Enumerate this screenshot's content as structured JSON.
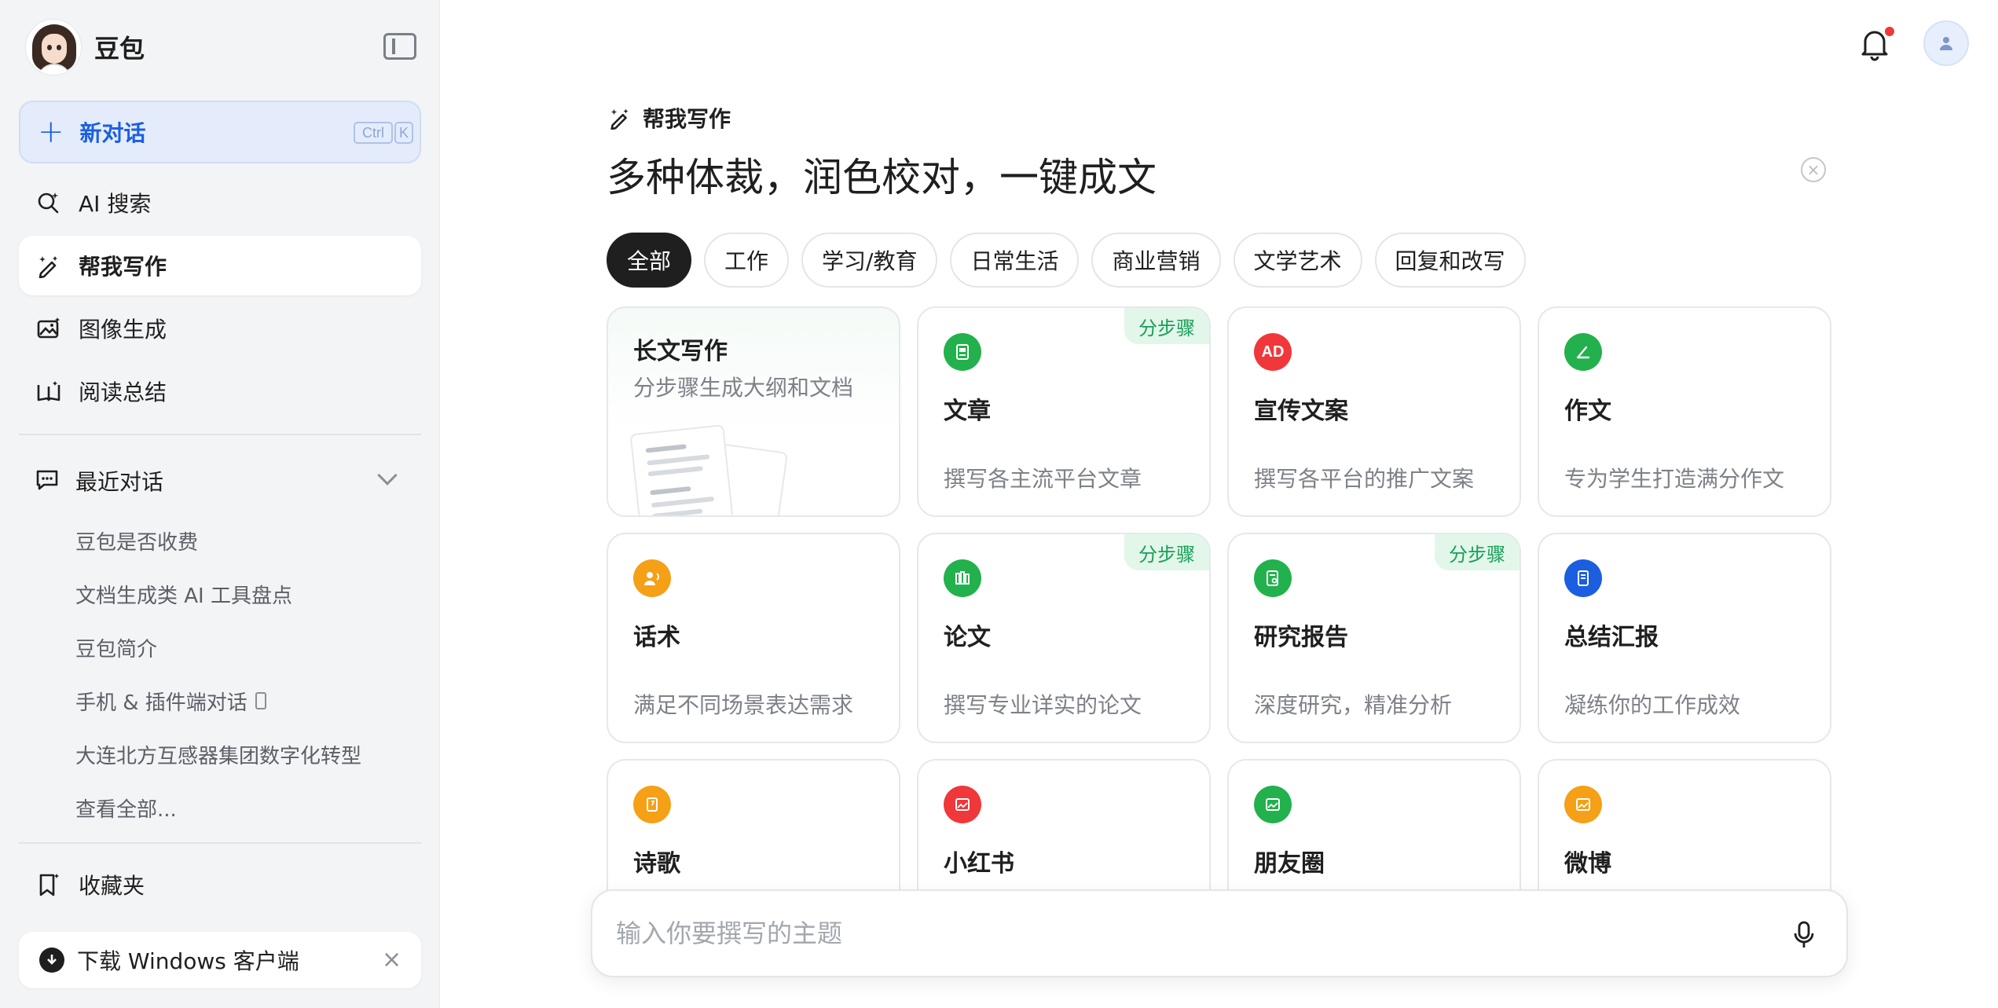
{
  "brand": {
    "name": "豆包"
  },
  "sidebar": {
    "new_chat": {
      "label": "新对话",
      "shortcut_ctrl": "Ctrl",
      "shortcut_key": "K"
    },
    "nav": [
      {
        "label": "AI 搜索",
        "icon": "search-sparkle-icon"
      },
      {
        "label": "帮我写作",
        "icon": "pen-sparkle-icon",
        "active": true
      },
      {
        "label": "图像生成",
        "icon": "image-icon"
      },
      {
        "label": "阅读总结",
        "icon": "book-icon"
      }
    ],
    "recent": {
      "title": "最近对话",
      "items": [
        "豆包是否收费",
        "文档生成类 AI 工具盘点",
        "豆包简介",
        "手机 & 插件端对话",
        "大连北方互感器集团数字化转型",
        "查看全部..."
      ]
    },
    "favorites": {
      "label": "收藏夹"
    },
    "download": {
      "label": "下载 Windows 客户端"
    }
  },
  "main": {
    "section_title": "帮我写作",
    "headline": "多种体裁，润色校对，一键成文",
    "tabs": [
      "全部",
      "工作",
      "学习/教育",
      "日常生活",
      "商业营销",
      "文学艺术",
      "回复和改写"
    ],
    "cards": [
      {
        "title": "长文写作",
        "desc": "分步骤生成大纲和文档"
      },
      {
        "title": "文章",
        "desc": "撰写各主流平台文章",
        "badge": "分步骤",
        "color": "#22b14c"
      },
      {
        "title": "宣传文案",
        "desc": "撰写各平台的推广文案",
        "icon_text": "AD",
        "color": "#f0373a"
      },
      {
        "title": "作文",
        "desc": "专为学生打造满分作文",
        "color": "#22b14c"
      },
      {
        "title": "话术",
        "desc": "满足不同场景表达需求",
        "color": "#f5a017"
      },
      {
        "title": "论文",
        "desc": "撰写专业详实的论文",
        "badge": "分步骤",
        "color": "#22b14c"
      },
      {
        "title": "研究报告",
        "desc": "深度研究，精准分析",
        "badge": "分步骤",
        "color": "#22b14c"
      },
      {
        "title": "总结汇报",
        "desc": "凝练你的工作成效",
        "color": "#1b5fe0"
      },
      {
        "title": "诗歌",
        "color": "#f5a017"
      },
      {
        "title": "小红书",
        "color": "#f0373a"
      },
      {
        "title": "朋友圈",
        "color": "#22b14c"
      },
      {
        "title": "微博",
        "color": "#f5a017"
      }
    ],
    "input": {
      "placeholder": "输入你要撰写的主题"
    }
  },
  "colors": {
    "accent": "#1b5fe0",
    "green": "#22b14c",
    "red": "#f0373a",
    "orange": "#f5a017"
  }
}
